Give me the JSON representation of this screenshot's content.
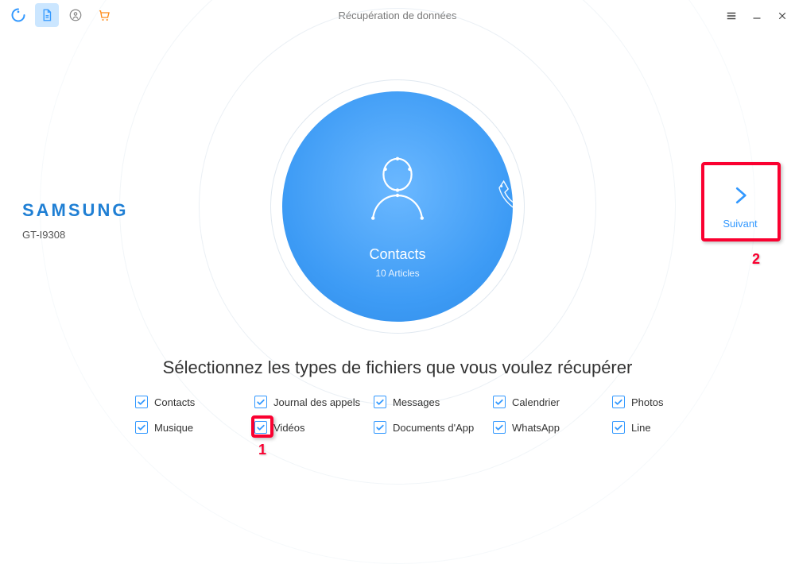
{
  "header": {
    "title": "Récupération de données"
  },
  "device": {
    "brand": "SAMSUNG",
    "model": "GT-I9308"
  },
  "selected_category": {
    "title": "Contacts",
    "subtitle": "10 Articles"
  },
  "next": {
    "label": "Suivant"
  },
  "instruction": "Sélectionnez les types de fichiers que vous voulez récupérer",
  "types": [
    {
      "label": "Contacts",
      "checked": true
    },
    {
      "label": "Journal des appels",
      "checked": true
    },
    {
      "label": "Messages",
      "checked": true
    },
    {
      "label": "Calendrier",
      "checked": true
    },
    {
      "label": "Photos",
      "checked": true
    },
    {
      "label": "Musique",
      "checked": true
    },
    {
      "label": "Vidéos",
      "checked": true
    },
    {
      "label": "Documents d'App",
      "checked": true
    },
    {
      "label": "WhatsApp",
      "checked": true
    },
    {
      "label": "Line",
      "checked": true
    }
  ],
  "annotations": {
    "num1": "1",
    "num2": "2"
  }
}
